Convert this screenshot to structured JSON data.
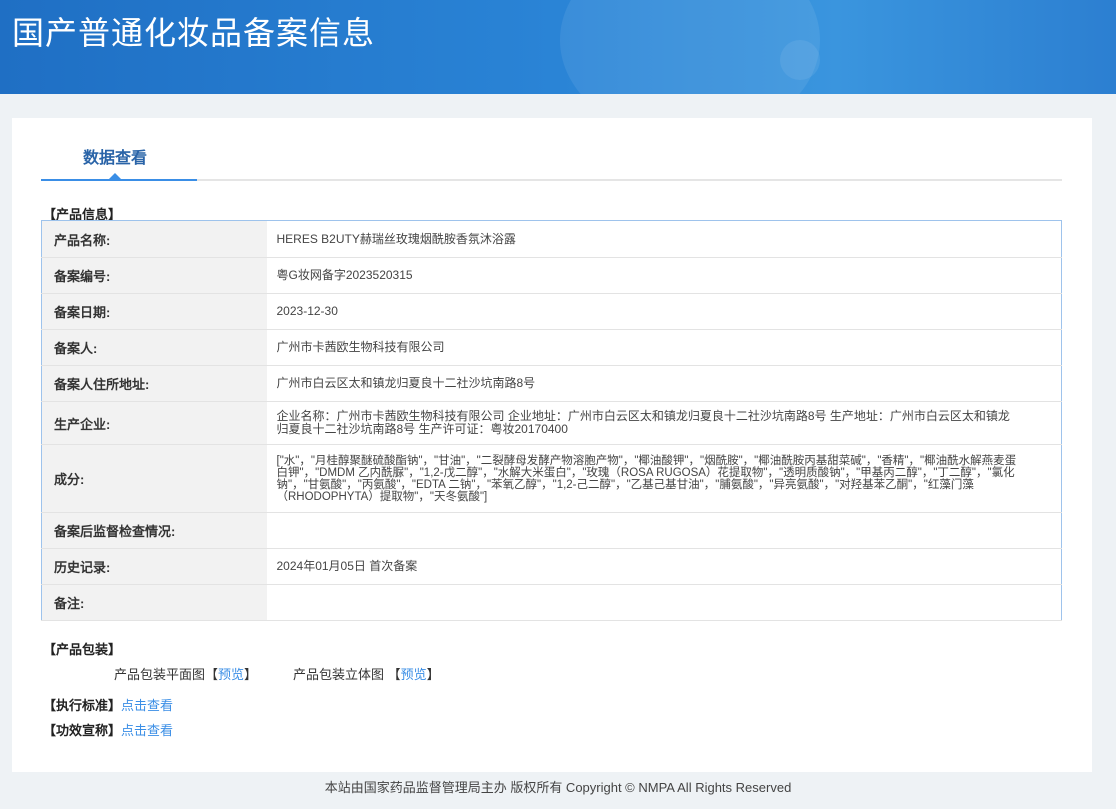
{
  "header": {
    "title": "国产普通化妆品备案信息"
  },
  "tab": {
    "label": "数据查看"
  },
  "sections": {
    "product_info": "【产品信息】",
    "packaging": "【产品包装】",
    "standard": "【执行标准】",
    "claims": "【功效宣称】"
  },
  "product": {
    "rows": [
      {
        "label": "产品名称:",
        "value": "HERES B2UTY赫瑞丝玫瑰烟酰胺香氛沐浴露"
      },
      {
        "label": "备案编号:",
        "value": "粤G妆网备字2023520315"
      },
      {
        "label": "备案日期:",
        "value": "2023-12-30"
      },
      {
        "label": "备案人:",
        "value": "广州市卡茜欧生物科技有限公司"
      },
      {
        "label": "备案人住所地址:",
        "value": "广州市白云区太和镇龙归夏良十二社沙坑南路8号"
      },
      {
        "label": "生产企业:",
        "value": "企业名称：广州市卡茜欧生物科技有限公司 企业地址：广州市白云区太和镇龙归夏良十二社沙坑南路8号 生产地址：广州市白云区太和镇龙归夏良十二社沙坑南路8号 生产许可证：粤妆20170400"
      },
      {
        "label": "成分:",
        "value": "[\"水\"，\"月桂醇聚醚硫酸酯钠\"，\"甘油\"，\"二裂酵母发酵产物溶胞产物\"，\"椰油酸钾\"，\"烟酰胺\"，\"椰油酰胺丙基甜菜碱\"，\"香精\"，\"椰油酰水解燕麦蛋白钾\"，\"DMDM 乙内酰脲\"，\"1,2-戊二醇\"，\"水解大米蛋白\"，\"玫瑰（ROSA RUGOSA）花提取物\"，\"透明质酸钠\"，\"甲基丙二醇\"，\"丁二醇\"，\"氯化钠\"，\"甘氨酸\"，\"丙氨酸\"，\"EDTA 二钠\"，\"苯氧乙醇\"，\"1,2-己二醇\"，\"乙基己基甘油\"，\"脯氨酸\"，\"异亮氨酸\"，\"对羟基苯乙酮\"，\"红藻门藻（RHODOPHYTA）提取物\"，\"天冬氨酸\"]"
      },
      {
        "label": "备案后监督检查情况:",
        "value": ""
      },
      {
        "label": "历史记录:",
        "value": "2024年01月05日 首次备案"
      },
      {
        "label": "备注:",
        "value": ""
      }
    ]
  },
  "packaging": {
    "flat_label": "产品包装平面图",
    "solid_label": "产品包装立体图",
    "preview": "预览",
    "lb": "【",
    "rb": "】"
  },
  "links": {
    "view": "点击查看"
  },
  "footer": {
    "text": "本站由国家药品监督管理局主办 版权所有 Copyright © NMPA All Rights Reserved"
  }
}
